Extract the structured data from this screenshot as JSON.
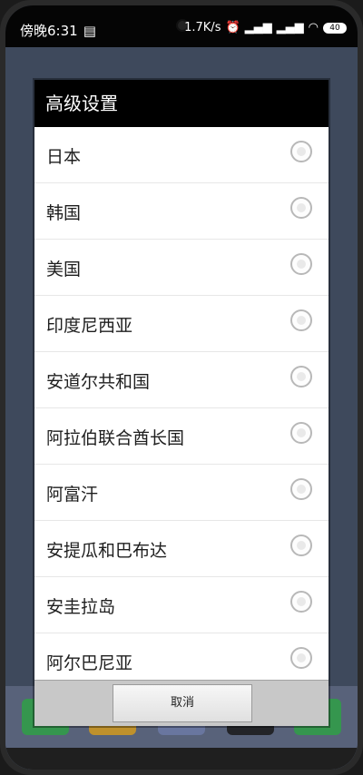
{
  "status_bar": {
    "time": "傍晚6:31",
    "speed": "1.7K/s",
    "battery": "40",
    "icons": [
      "note-icon",
      "alarm-icon",
      "signal-icon",
      "signal-icon",
      "wifi-icon",
      "battery-icon"
    ]
  },
  "dialog": {
    "title": "高级设置",
    "items": [
      {
        "label": "日本",
        "selected": false
      },
      {
        "label": "韩国",
        "selected": false
      },
      {
        "label": "美国",
        "selected": false
      },
      {
        "label": "印度尼西亚",
        "selected": false
      },
      {
        "label": "安道尔共和国",
        "selected": false
      },
      {
        "label": "阿拉伯联合酋长国",
        "selected": false
      },
      {
        "label": "阿富汗",
        "selected": false
      },
      {
        "label": "安提瓜和巴布达",
        "selected": false
      },
      {
        "label": "安圭拉岛",
        "selected": false
      },
      {
        "label": "阿尔巴尼亚",
        "selected": false
      }
    ],
    "cancel_label": "取消"
  },
  "colors": {
    "dialog_title_bg": "#000000",
    "dialog_bg": "#ffffff",
    "background_app": "#3e495c",
    "radio_border": "#b8b8b8"
  }
}
